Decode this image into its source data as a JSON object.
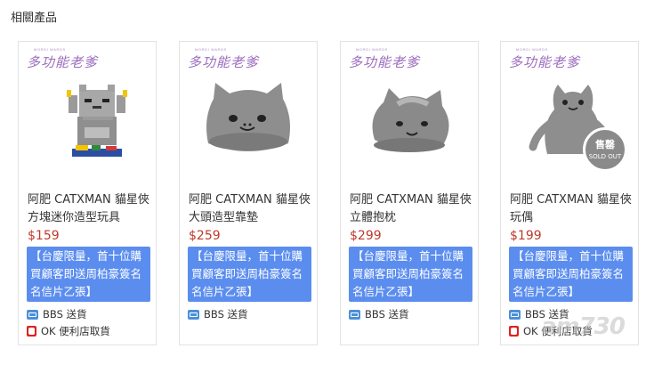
{
  "section_title": "相關產品",
  "brand": {
    "logo_text": "多功能老爹",
    "tiny_text": "MORDI WARDS"
  },
  "products": [
    {
      "name": "阿肥 CATXMAN 貓星俠 方塊迷你造型玩具",
      "price": "$159",
      "promo": "【台慶限量，首十位購買顧客即送周柏豪簽名名信片乙張】",
      "shipping": [
        {
          "icon": "bbs-icon",
          "label": "BBS 送貨"
        },
        {
          "icon": "ok-store-icon",
          "label": "OK 便利店取貨"
        }
      ],
      "sold_out": false
    },
    {
      "name": "阿肥 CATXMAN 貓星俠 大頭造型靠墊",
      "price": "$259",
      "promo": "【台慶限量，首十位購買顧客即送周柏豪簽名名信片乙張】",
      "shipping": [
        {
          "icon": "bbs-icon",
          "label": "BBS 送貨"
        }
      ],
      "sold_out": false
    },
    {
      "name": "阿肥 CATXMAN 貓星俠 立體抱枕",
      "price": "$299",
      "promo": "【台慶限量，首十位購買顧客即送周柏豪簽名名信片乙張】",
      "shipping": [
        {
          "icon": "bbs-icon",
          "label": "BBS 送貨"
        }
      ],
      "sold_out": false
    },
    {
      "name": "阿肥 CATXMAN 貓星俠 玩偶",
      "price": "$199",
      "promo": "【台慶限量，首十位購買顧客即送周柏豪簽名名信片乙張】",
      "shipping": [
        {
          "icon": "bbs-icon",
          "label": "BBS 送貨"
        },
        {
          "icon": "ok-store-icon",
          "label": "OK 便利店取貨"
        }
      ],
      "sold_out": true
    }
  ],
  "sold_out_badge": {
    "zh": "售罄",
    "en": "SOLD OUT"
  },
  "watermark": "am730",
  "colors": {
    "promo_bg": "#5b8def",
    "price": "#c0392b",
    "brand": "#9b6bbd"
  }
}
